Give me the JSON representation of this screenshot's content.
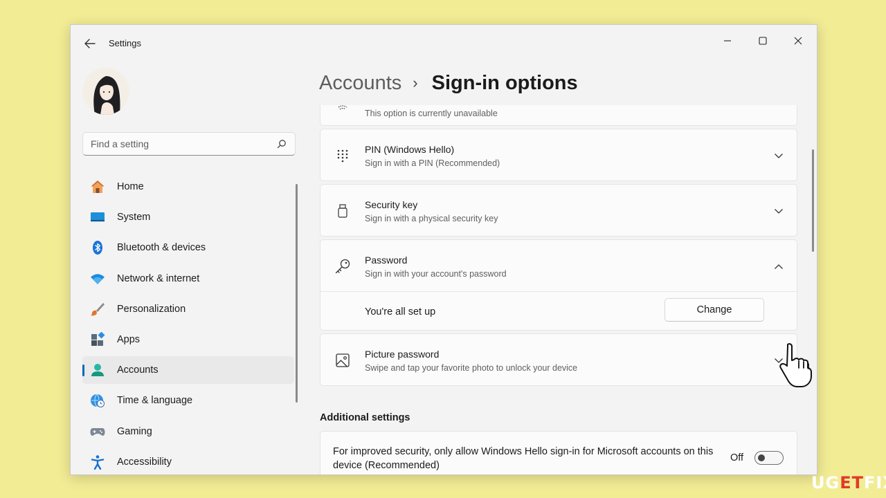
{
  "window": {
    "title": "Settings"
  },
  "search": {
    "placeholder": "Find a setting"
  },
  "nav": {
    "items": [
      {
        "label": "Home",
        "icon": "home-icon",
        "selected": false
      },
      {
        "label": "System",
        "icon": "system-icon",
        "selected": false
      },
      {
        "label": "Bluetooth & devices",
        "icon": "bluetooth-icon",
        "selected": false
      },
      {
        "label": "Network & internet",
        "icon": "wifi-icon",
        "selected": false
      },
      {
        "label": "Personalization",
        "icon": "brush-icon",
        "selected": false
      },
      {
        "label": "Apps",
        "icon": "apps-icon",
        "selected": false
      },
      {
        "label": "Accounts",
        "icon": "accounts-icon",
        "selected": true
      },
      {
        "label": "Time & language",
        "icon": "globe-clock-icon",
        "selected": false
      },
      {
        "label": "Gaming",
        "icon": "gamepad-icon",
        "selected": false
      },
      {
        "label": "Accessibility",
        "icon": "accessibility-icon",
        "selected": false
      }
    ]
  },
  "breadcrumb": {
    "parent": "Accounts",
    "separator": "›",
    "current": "Sign-in options"
  },
  "options": {
    "partial": {
      "subtitle": "This option is currently unavailable",
      "icon": "fingerprint-icon"
    },
    "pin": {
      "title": "PIN (Windows Hello)",
      "subtitle": "Sign in with a PIN (Recommended)",
      "icon": "pin-keypad-icon"
    },
    "security_key": {
      "title": "Security key",
      "subtitle": "Sign in with a physical security key",
      "icon": "usb-key-icon"
    },
    "password": {
      "title": "Password",
      "subtitle": "Sign in with your account's password",
      "icon": "key-icon",
      "status": "You're all set up",
      "button": "Change"
    },
    "picture_password": {
      "title": "Picture password",
      "subtitle": "Swipe and tap your favorite photo to unlock your device",
      "icon": "picture-icon"
    }
  },
  "additional": {
    "heading": "Additional settings",
    "hello_only": {
      "text": "For improved security, only allow Windows Hello sign-in for Microsoft accounts on this device (Recommended)",
      "toggle_label": "Off",
      "toggle_on": false
    }
  },
  "watermark": {
    "left": "UG",
    "accent": "ET",
    "right": "FIX"
  },
  "colors": {
    "accent": "#0067c0",
    "background": "#f2ec95",
    "window": "#f3f3f3",
    "card": "#fbfbfb"
  }
}
